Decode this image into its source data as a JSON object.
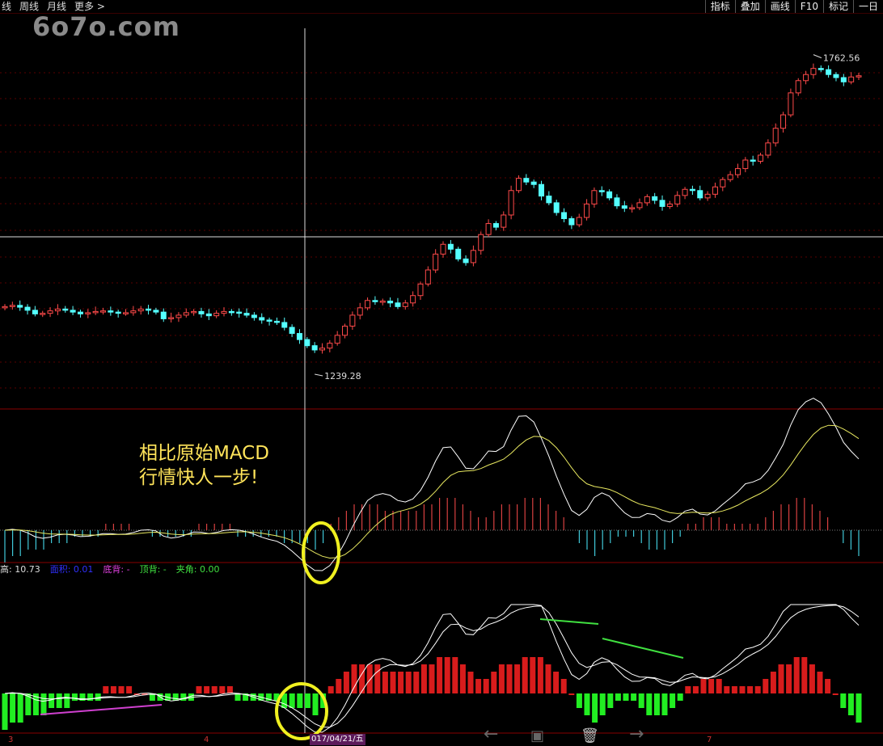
{
  "toolbar": {
    "left_items": [
      "线",
      "周线",
      "月线",
      "更多 >"
    ],
    "right_items": [
      "指标",
      "叠加",
      "画线",
      "F10",
      "标记",
      "一日"
    ]
  },
  "watermark": "6o7o.com",
  "annotation": {
    "line1": "相比原始MACD",
    "line2": "行情快人一步!"
  },
  "indicator": {
    "items": [
      {
        "label": "高: 10.73",
        "color": "#dddddd"
      },
      {
        "label": "面积: 0.01",
        "color": "#3030ff"
      },
      {
        "label": "底背: -",
        "color": "#e040e0"
      },
      {
        "label": "顶背: -",
        "color": "#40e040"
      },
      {
        "label": "夹角: 0.00",
        "color": "#40e040"
      }
    ]
  },
  "bottom": {
    "date_label": "017/04/21/五",
    "tick_left": "3",
    "tick_mid": "4",
    "tick_right": "7"
  },
  "colors": {
    "up": "#ff4a4a",
    "down": "#54ffff",
    "ma_white": "#ffffff",
    "ma_yellow": "#e8e860",
    "hist_red": "#d81c1c",
    "hist_green": "#22ee22",
    "annot": "#ffe45a"
  },
  "chart_data": {
    "type": "candlestick",
    "price_labels": {
      "high": "1762.56",
      "low": "1239.28"
    },
    "high": 1762.56,
    "low": 1239.28,
    "closes": [
      1350,
      1352,
      1349,
      1344,
      1338,
      1339,
      1343,
      1346,
      1344,
      1341,
      1338,
      1340,
      1342,
      1343,
      1341,
      1339,
      1340,
      1343,
      1346,
      1344,
      1341,
      1330,
      1332,
      1336,
      1340,
      1342,
      1338,
      1335,
      1339,
      1342,
      1341,
      1339,
      1336,
      1332,
      1328,
      1326,
      1324,
      1316,
      1306,
      1296,
      1286,
      1279,
      1282,
      1290,
      1303,
      1318,
      1336,
      1348,
      1360,
      1358,
      1359,
      1356,
      1350,
      1356,
      1368,
      1387,
      1410,
      1436,
      1452,
      1444,
      1428,
      1422,
      1442,
      1468,
      1486,
      1480,
      1500,
      1540,
      1560,
      1554,
      1550,
      1531,
      1520,
      1504,
      1494,
      1484,
      1496,
      1518,
      1540,
      1538,
      1528,
      1515,
      1511,
      1512,
      1520,
      1530,
      1524,
      1514,
      1518,
      1532,
      1542,
      1540,
      1528,
      1534,
      1546,
      1558,
      1566,
      1576,
      1590,
      1588,
      1598,
      1618,
      1642,
      1664,
      1700,
      1720,
      1730,
      1740,
      1738,
      1730,
      1725,
      1718,
      1726,
      1728
    ],
    "hist": [
      -5,
      -4,
      -4,
      -3,
      -3,
      -3,
      -2,
      -2,
      -2,
      -1,
      -1,
      -1,
      -1,
      1,
      1,
      1,
      1,
      0,
      0,
      -1,
      -1,
      -1,
      -1,
      -1,
      -1,
      1,
      1,
      1,
      1,
      1,
      -1,
      -1,
      -1,
      -1,
      -1,
      -1,
      -2,
      -2,
      -2,
      -2,
      -3,
      -2,
      1,
      2,
      3,
      4,
      4,
      4,
      4,
      3,
      3,
      3,
      3,
      3,
      4,
      4,
      5,
      5,
      5,
      4,
      3,
      2,
      2,
      3,
      4,
      4,
      4,
      5,
      5,
      5,
      4,
      3,
      2,
      0,
      -2,
      -3,
      -4,
      -3,
      -2,
      -1,
      -1,
      -1,
      -2,
      -3,
      -3,
      -3,
      -2,
      -1,
      1,
      1,
      2,
      2,
      2,
      1,
      1,
      1,
      1,
      1,
      2,
      3,
      4,
      4,
      5,
      5,
      4,
      3,
      2,
      0,
      -2,
      -3,
      -4
    ]
  }
}
